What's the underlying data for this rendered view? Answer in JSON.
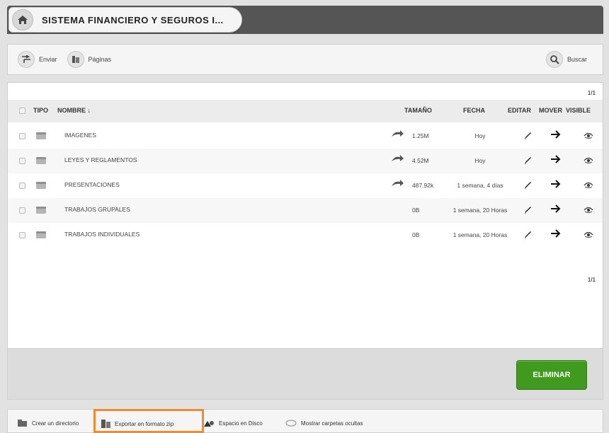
{
  "header": {
    "title": "SISTEMA FINANCIERO Y SEGUROS I..."
  },
  "toolbar": {
    "send_label": "Enviar",
    "pages_label": "Páginas",
    "search_label": "Buscar"
  },
  "pager": {
    "top": "1/1",
    "bottom": "1/1"
  },
  "table": {
    "columns": {
      "tipo": "TIPO",
      "nombre": "NOMBRE ↓",
      "tamano": "TAMAÑO",
      "fecha": "FECHA",
      "editar": "EDITAR",
      "mover": "MOVER",
      "visible": "VISIBLE"
    },
    "rows": [
      {
        "name": "IMAGENES",
        "size": "1.25M",
        "date": "Hoy",
        "shared": true
      },
      {
        "name": "LEYES Y REGLAMENTOS",
        "size": "4.52M",
        "date": "Hoy",
        "shared": true
      },
      {
        "name": "PRESENTACIONES",
        "size": "487.92k",
        "date": "1 semana, 4 días",
        "shared": true
      },
      {
        "name": "TRABAJOS GRUPALES",
        "size": "0B",
        "date": "1 semana, 20 Horas",
        "shared": false
      },
      {
        "name": "TRABAJOS INDIVIDUALES",
        "size": "0B",
        "date": "1 semana, 20 Horas",
        "shared": false
      }
    ]
  },
  "actions": {
    "delete_label": "ELIMINAR"
  },
  "bottombar": {
    "create_dir": "Crear un directorio",
    "export_zip": "Exportar en formato zip",
    "disk_space": "Espacio en Disco",
    "show_hidden": "Mostrar carpetas ocultas"
  },
  "colors": {
    "accent_green": "#3f9a1d",
    "highlight_orange": "#f28b30",
    "header_dark": "#555555"
  },
  "icons": [
    "home-icon",
    "send-icon",
    "pages-icon",
    "search-icon",
    "folder-icon",
    "share-icon",
    "pencil-icon",
    "arrow-right-icon",
    "eye-icon",
    "folder-add-icon",
    "zip-icon",
    "disk-icon",
    "hidden-folder-icon"
  ]
}
